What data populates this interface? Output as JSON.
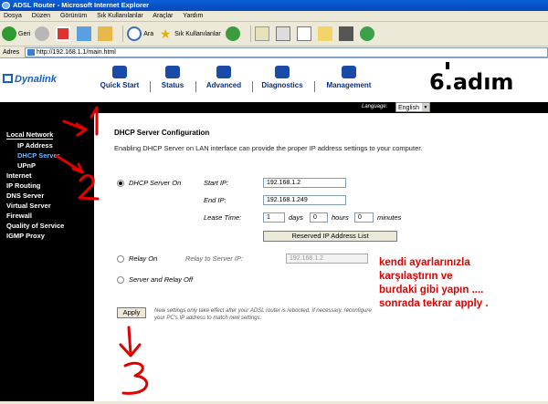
{
  "window": {
    "title": "ADSL Router - Microsoft Internet Explorer"
  },
  "menubar": {
    "items": [
      "Dosya",
      "Düzen",
      "Görünüm",
      "Sık Kullanılanlar",
      "Araçlar",
      "Yardım"
    ]
  },
  "toolbar": {
    "back_label": "Geri",
    "search_label": "Ara",
    "favorites_label": "Sık Kullanılanlar"
  },
  "address": {
    "label": "Adres",
    "url": "http://192.168.1.1/main.html"
  },
  "router": {
    "logo": "Dynalink",
    "nav": [
      "Quick Start",
      "Status",
      "Advanced",
      "Diagnostics",
      "Management"
    ],
    "language_label": "Language:",
    "language_value": "English",
    "sidebar": [
      "Local Network",
      "IP Address",
      "DHCP Server",
      "UPnP",
      "Internet",
      "IP Routing",
      "DNS Server",
      "Virtual Server",
      "Firewall",
      "Quality of Service",
      "IGMP Proxy"
    ],
    "content": {
      "title": "DHCP Server Configuration",
      "description": "Enabling DHCP Server on LAN interface can provide the proper IP address settings to your computer.",
      "dhcp_on_label": "DHCP Server On",
      "start_ip_label": "Start IP:",
      "start_ip": "192.168.1.2",
      "end_ip_label": "End IP:",
      "end_ip": "192.168.1.249",
      "lease_label": "Lease Time:",
      "lease_days": "1",
      "days_label": "days",
      "lease_hours": "0",
      "hours_label": "hours",
      "lease_minutes": "0",
      "minutes_label": "minutes",
      "reserved_button": "Reserved IP Address List",
      "relay_on_label": "Relay On",
      "relay_server_label": "Relay to Server IP:",
      "relay_server_ip": "192.168.1.2",
      "server_relay_off_label": "Server and Relay Off",
      "apply_button": "Apply",
      "note": "New settings only take effect after your ADSL router is rebooted. If necessary, reconfigure your PC's IP address to match new settings."
    }
  },
  "annotations": {
    "step_title": "6.adım",
    "markers": [
      "1",
      "2",
      "3"
    ],
    "instruction_lines": [
      "kendi ayarlarınızla",
      "karşılaştırın ve",
      "burdaki gibi yapın ....",
      "sonrada tekrar apply ."
    ],
    "color": "#e00000"
  }
}
